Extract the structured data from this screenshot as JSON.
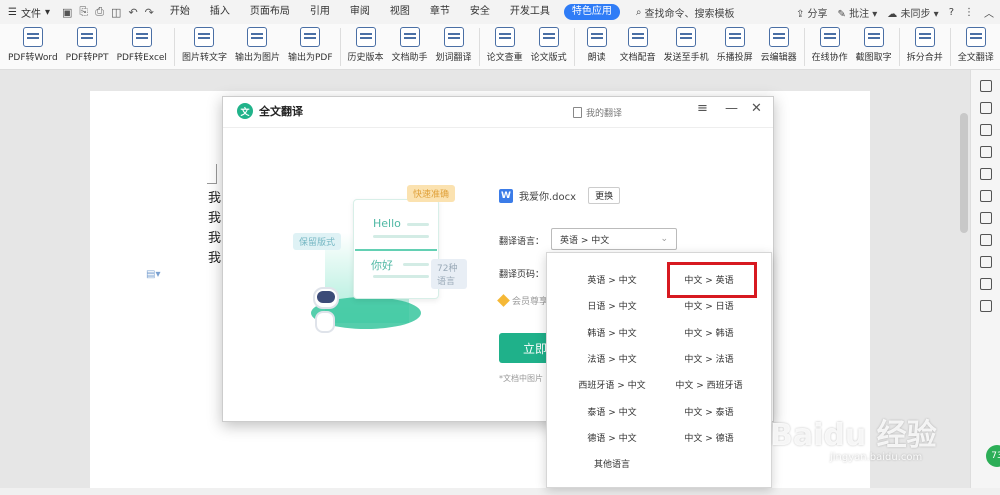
{
  "menubar": {
    "file_label": "文件",
    "tabs": [
      "开始",
      "插入",
      "页面布局",
      "引用",
      "审阅",
      "视图",
      "章节",
      "安全",
      "开发工具",
      "特色应用"
    ],
    "active_tab": "特色应用",
    "search_placeholder": "查找命令、搜索模板",
    "share": "分享",
    "comment": "批注",
    "sync": "未同步",
    "help": "?"
  },
  "ribbon": {
    "items": [
      "PDF转Word",
      "PDF转PPT",
      "PDF转Excel",
      "图片转文字",
      "输出为图片",
      "输出为PDF",
      "历史版本",
      "文档助手",
      "划词翻译",
      "论文查重",
      "论文版式",
      "朗读",
      "文档配音",
      "发送至手机",
      "乐播投屏",
      "云编辑器",
      "在线协作",
      "截图取字",
      "拆分合并",
      "全文翻译"
    ]
  },
  "document": {
    "lines": [
      "我",
      "我",
      "我",
      "我"
    ]
  },
  "dialog": {
    "title": "全文翻译",
    "my_translations": "我的翻译",
    "file_name": "我爱你.docx",
    "change_button": "更换",
    "lang_label": "翻译语言：",
    "lang_value": "英语 > 中文",
    "pages_label": "翻译页码：",
    "vip_text": "会员尊享",
    "start_button": "立即",
    "note": "*文档中图片",
    "illustration": {
      "tag_fast": "快速准确",
      "tag_keep": "保留版式",
      "tag_72": "72种语言",
      "hello": "Hello",
      "nihao": "你好"
    }
  },
  "dropdown": {
    "left": [
      "英语 > 中文",
      "日语 > 中文",
      "韩语 > 中文",
      "法语 > 中文",
      "西班牙语 > 中文",
      "泰语 > 中文",
      "德语 > 中文"
    ],
    "right": [
      "中文 > 英语",
      "中文 > 日语",
      "中文 > 韩语",
      "中文 > 法语",
      "中文 > 西班牙语",
      "中文 > 泰语",
      "中文 > 德语"
    ],
    "other": "其他语言",
    "highlighted": "中文 > 英语"
  },
  "watermark": {
    "main": "Baidu 经验",
    "sub": "jingyan.baidu.com"
  },
  "badge": "73",
  "colors": {
    "accent": "#2f7cf6",
    "brand_green": "#1fb18a",
    "highlight_red": "#d71920"
  }
}
